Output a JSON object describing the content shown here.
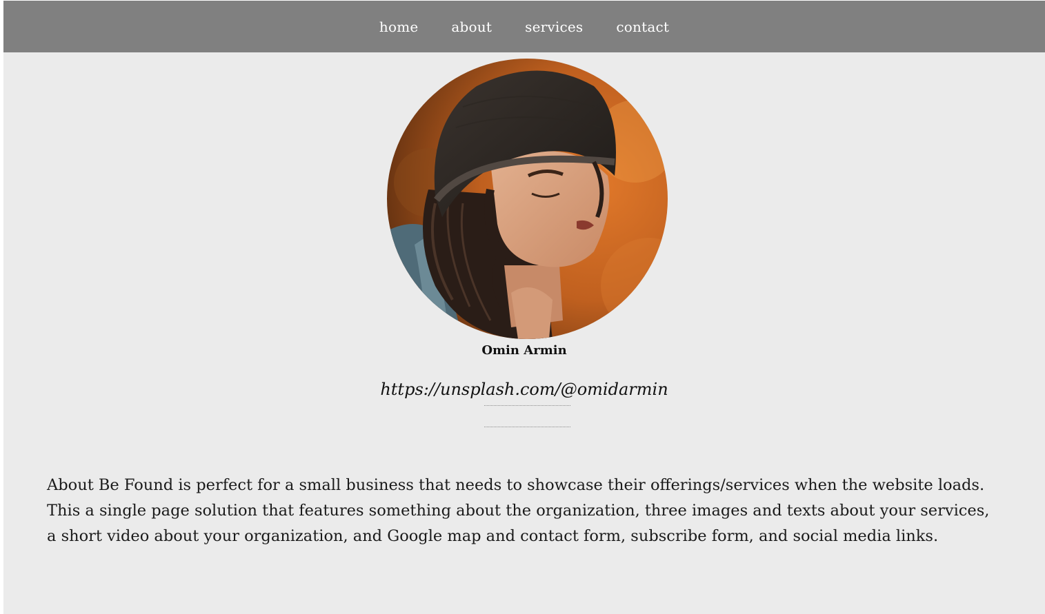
{
  "nav": {
    "items": [
      {
        "label": "home"
      },
      {
        "label": "about"
      },
      {
        "label": "services"
      },
      {
        "label": "contact"
      }
    ]
  },
  "profile": {
    "name": "Omin Armin",
    "url": "https://unsplash.com/@omidarmin"
  },
  "about": {
    "text": "About Be Found is perfect for a small business that needs to showcase their offerings/services when the website loads. This a single page solution that features something about the organization, three images and texts about your services, a short video about your organization, and Google map and contact form, subscribe form, and social media links."
  },
  "colors": {
    "navbar": "#808080",
    "background": "#ebebeb",
    "nav_text": "#ffffff"
  }
}
